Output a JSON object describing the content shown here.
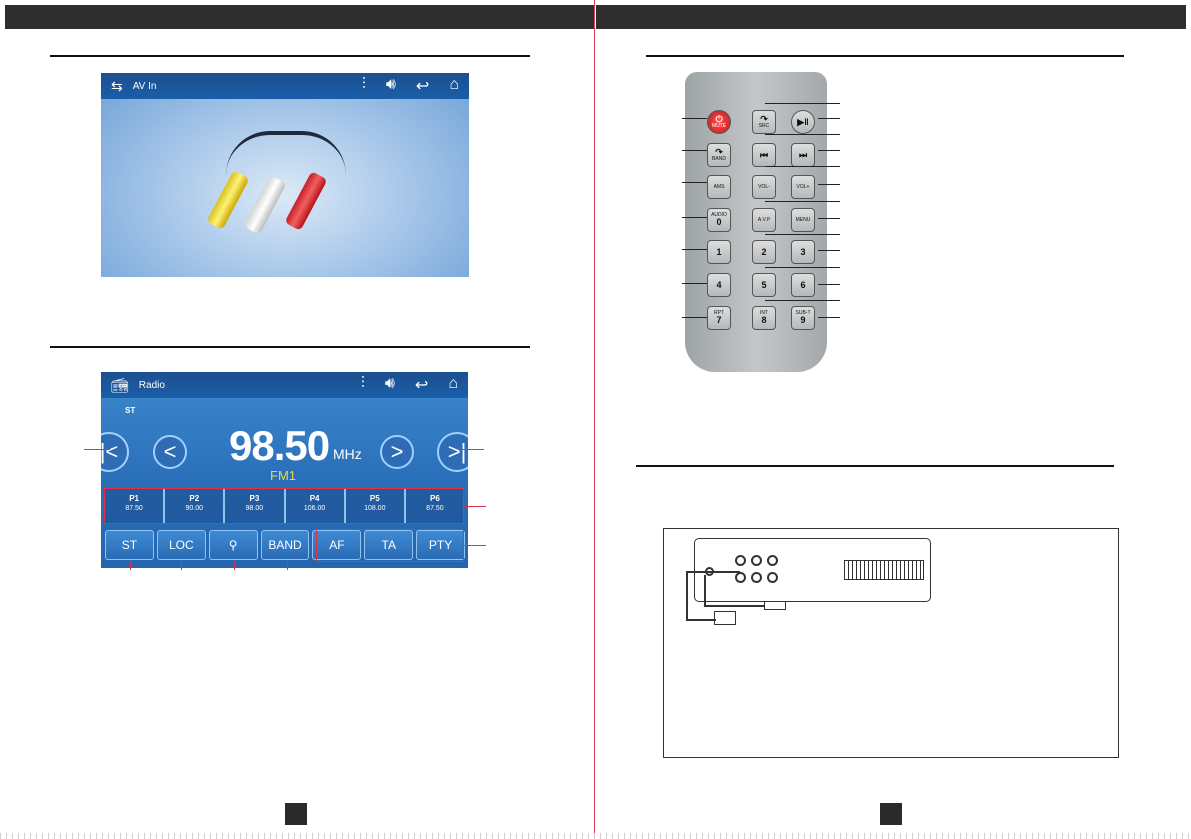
{
  "av_screen": {
    "title": "AV In",
    "icons": [
      "source-icon",
      "equalizer-icon",
      "volume-icon",
      "back-icon",
      "home-icon"
    ]
  },
  "radio_screen": {
    "title": "Radio",
    "stereo": "ST",
    "frequency": "98.50",
    "unit": "MHz",
    "band": "FM1",
    "presets": [
      {
        "label": "P1",
        "value": "87.50"
      },
      {
        "label": "P2",
        "value": "90.00"
      },
      {
        "label": "P3",
        "value": "98.00"
      },
      {
        "label": "P4",
        "value": "106.00"
      },
      {
        "label": "P5",
        "value": "108.00"
      },
      {
        "label": "P6",
        "value": "87.50"
      }
    ],
    "buttons": [
      "ST",
      "LOC",
      "BAND",
      "AF",
      "TA",
      "PTY"
    ]
  },
  "remote": {
    "mute": "MUTE",
    "src": "SRC",
    "band": "BAND",
    "ams": "AMS",
    "vol_minus": "VOL-",
    "vol_plus": "VOL+",
    "audio": "AUDIO",
    "avp": "A.V.P",
    "menu": "MENU",
    "rpt": "RPT",
    "int": "INT",
    "subt": "SUB-T",
    "digits": [
      "0",
      "1",
      "2",
      "3",
      "4",
      "5",
      "6",
      "7",
      "8",
      "9"
    ]
  },
  "colors": {
    "accent_red": "#e03048",
    "screen_blue": "#2f6db6",
    "band_yellow": "#f2d34a"
  }
}
